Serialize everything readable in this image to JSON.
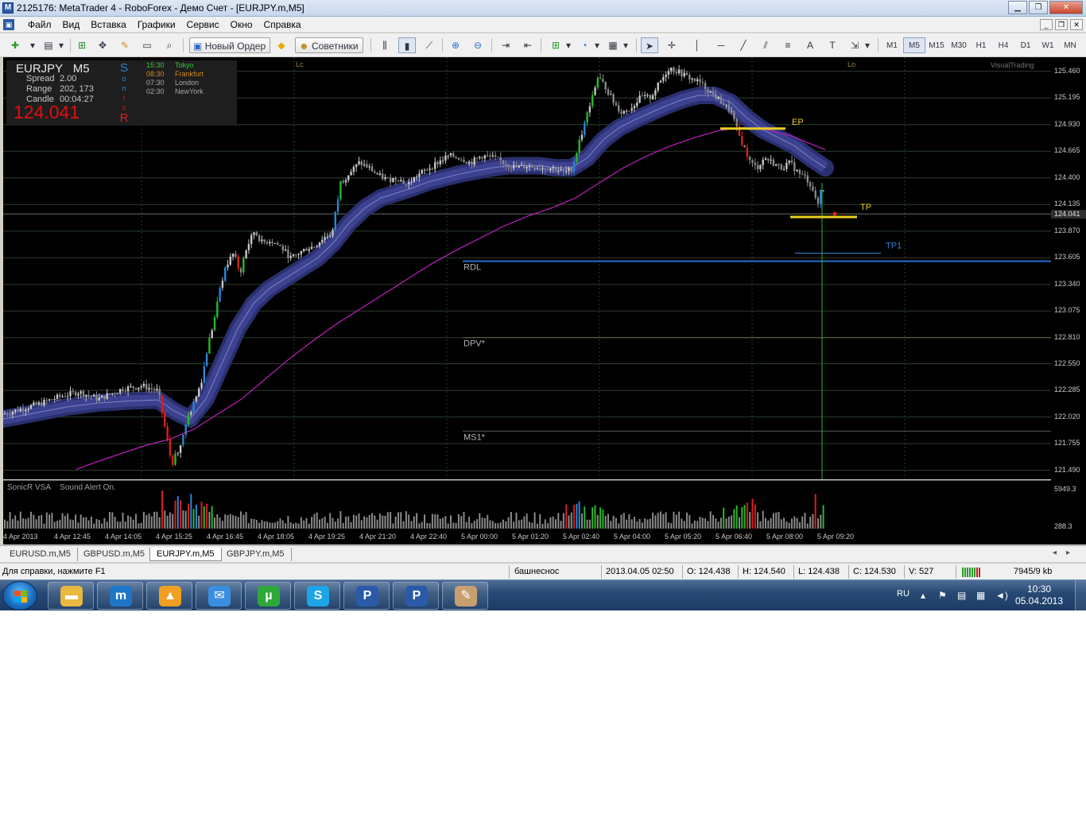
{
  "window": {
    "title": "2125176: MetaTrader 4 - RoboForex - Демо Счет - [EURJPY.m,M5]",
    "app_icon": "metatrader-icon",
    "controls": [
      "minimize",
      "maximize",
      "close"
    ]
  },
  "menubar": {
    "items": [
      "Файл",
      "Вид",
      "Вставка",
      "Графики",
      "Сервис",
      "Окно",
      "Справка"
    ]
  },
  "toolbar": {
    "new_order_label": "Новый Ордер",
    "experts_label": "Советники",
    "timeframes": [
      "M1",
      "M5",
      "M15",
      "M30",
      "H1",
      "H4",
      "D1",
      "W1",
      "MN"
    ],
    "selected_timeframe": "M5"
  },
  "infobox": {
    "symbol": "EURJPY",
    "timeframe": "M5",
    "spread_label": "Spread",
    "spread_value": "2.00",
    "range_label": "Range",
    "range_value": "202, 173",
    "candle_label": "Candle",
    "candle_value": "00:04:27",
    "price": "124.041",
    "sonic_letters": [
      "S",
      "o",
      "n",
      "i",
      "c",
      "R"
    ],
    "sessions": [
      {
        "time": "15:30",
        "name": "Tokyo",
        "color": "#3cc43c"
      },
      {
        "time": "08:30",
        "name": "Frankfurt",
        "color": "#d08820"
      },
      {
        "time": "07:30",
        "name": "London",
        "color": "#a8a8a8"
      },
      {
        "time": "02:30",
        "name": "NewYork",
        "color": "#a8a8a8"
      }
    ]
  },
  "chart": {
    "symbol": "EURJPY.m",
    "timeframe": "M5",
    "watermark": "VisualTrading",
    "session_markers": [
      "Lc",
      "Lo"
    ],
    "levels": [
      {
        "label": "RDL",
        "price": 123.57,
        "color": "#1f6fd0"
      },
      {
        "label": "DPV*",
        "price": 122.81,
        "color": "#6a6a3a"
      },
      {
        "label": "MS1*",
        "price": 121.88,
        "color": "#555555"
      }
    ],
    "trade_marks": [
      {
        "label": "EP",
        "price": 124.89,
        "color": "#e8d020"
      },
      {
        "label": "TP",
        "price": 124.01,
        "color": "#e8d020"
      },
      {
        "label": "TP1",
        "price": 123.65,
        "color": "#2a86d8"
      }
    ],
    "price_axis": [
      "125.460",
      "125.195",
      "124.930",
      "124.665",
      "124.400",
      "124.135",
      "124.041",
      "123.870",
      "123.605",
      "123.340",
      "123.075",
      "122.810",
      "122.550",
      "122.285",
      "122.020",
      "121.755",
      "121.490"
    ],
    "current_price": "124.041",
    "price_min": 121.4,
    "price_max": 125.6,
    "time_axis": [
      "4 Apr 2013",
      "4 Apr 12:45",
      "4 Apr 14:05",
      "4 Apr 15:25",
      "4 Apr 16:45",
      "4 Apr 18:05",
      "4 Apr 19:25",
      "4 Apr 21:20",
      "4 Apr 22:40",
      "5 Apr 00:00",
      "5 Apr 01:20",
      "5 Apr 02:40",
      "5 Apr 04:00",
      "5 Apr 05:20",
      "5 Apr 06:40",
      "5 Apr 08:00",
      "5 Apr 09:20"
    ],
    "price_path": [
      [
        0,
        122.05
      ],
      [
        22,
        122.1
      ],
      [
        45,
        122.15
      ],
      [
        70,
        122.22
      ],
      [
        95,
        122.27
      ],
      [
        120,
        122.2
      ],
      [
        150,
        122.3
      ],
      [
        175,
        122.33
      ],
      [
        195,
        122.28
      ],
      [
        205,
        121.85
      ],
      [
        212,
        121.55
      ],
      [
        222,
        121.72
      ],
      [
        232,
        122.0
      ],
      [
        242,
        122.2
      ],
      [
        250,
        122.4
      ],
      [
        258,
        122.75
      ],
      [
        266,
        123.0
      ],
      [
        274,
        123.35
      ],
      [
        282,
        123.55
      ],
      [
        290,
        123.65
      ],
      [
        298,
        123.45
      ],
      [
        306,
        123.7
      ],
      [
        316,
        123.87
      ],
      [
        326,
        123.75
      ],
      [
        336,
        123.78
      ],
      [
        348,
        123.72
      ],
      [
        362,
        123.6
      ],
      [
        372,
        123.65
      ],
      [
        382,
        123.7
      ],
      [
        392,
        123.72
      ],
      [
        402,
        123.8
      ],
      [
        414,
        123.85
      ],
      [
        424,
        124.35
      ],
      [
        436,
        124.45
      ],
      [
        448,
        124.55
      ],
      [
        460,
        124.5
      ],
      [
        472,
        124.42
      ],
      [
        484,
        124.38
      ],
      [
        496,
        124.4
      ],
      [
        508,
        124.33
      ],
      [
        520,
        124.42
      ],
      [
        532,
        124.48
      ],
      [
        546,
        124.55
      ],
      [
        560,
        124.62
      ],
      [
        574,
        124.6
      ],
      [
        588,
        124.55
      ],
      [
        602,
        124.62
      ],
      [
        616,
        124.6
      ],
      [
        630,
        124.55
      ],
      [
        644,
        124.5
      ],
      [
        660,
        124.52
      ],
      [
        676,
        124.5
      ],
      [
        692,
        124.5
      ],
      [
        706,
        124.45
      ],
      [
        716,
        124.5
      ],
      [
        724,
        124.75
      ],
      [
        732,
        124.95
      ],
      [
        740,
        125.2
      ],
      [
        748,
        125.4
      ],
      [
        758,
        125.3
      ],
      [
        768,
        125.15
      ],
      [
        778,
        125.05
      ],
      [
        790,
        125.1
      ],
      [
        802,
        125.2
      ],
      [
        814,
        125.2
      ],
      [
        826,
        125.35
      ],
      [
        838,
        125.5
      ],
      [
        850,
        125.45
      ],
      [
        862,
        125.4
      ],
      [
        876,
        125.35
      ],
      [
        890,
        125.25
      ],
      [
        904,
        125.15
      ],
      [
        916,
        125.05
      ],
      [
        924,
        124.85
      ],
      [
        932,
        124.7
      ],
      [
        940,
        124.55
      ],
      [
        948,
        124.5
      ],
      [
        958,
        124.6
      ],
      [
        968,
        124.55
      ],
      [
        978,
        124.5
      ],
      [
        990,
        124.55
      ],
      [
        1000,
        124.45
      ],
      [
        1010,
        124.4
      ],
      [
        1018,
        124.3
      ],
      [
        1024,
        124.1
      ],
      [
        1030,
        124.35
      ],
      [
        1036,
        124.04
      ]
    ],
    "ema_band": [
      [
        0,
        122.0
      ],
      [
        40,
        122.06
      ],
      [
        80,
        122.12
      ],
      [
        120,
        122.16
      ],
      [
        160,
        122.18
      ],
      [
        195,
        122.19
      ],
      [
        215,
        122.08
      ],
      [
        235,
        122.0
      ],
      [
        255,
        122.2
      ],
      [
        275,
        122.55
      ],
      [
        295,
        122.9
      ],
      [
        315,
        123.15
      ],
      [
        335,
        123.3
      ],
      [
        355,
        123.4
      ],
      [
        375,
        123.5
      ],
      [
        395,
        123.6
      ],
      [
        415,
        123.75
      ],
      [
        435,
        123.95
      ],
      [
        455,
        124.1
      ],
      [
        475,
        124.2
      ],
      [
        495,
        124.25
      ],
      [
        515,
        124.3
      ],
      [
        535,
        124.36
      ],
      [
        555,
        124.4
      ],
      [
        575,
        124.44
      ],
      [
        595,
        124.47
      ],
      [
        615,
        124.5
      ],
      [
        635,
        124.52
      ],
      [
        655,
        124.52
      ],
      [
        675,
        124.52
      ],
      [
        695,
        124.5
      ],
      [
        715,
        124.5
      ],
      [
        735,
        124.6
      ],
      [
        755,
        124.78
      ],
      [
        775,
        124.9
      ],
      [
        795,
        124.98
      ],
      [
        815,
        125.05
      ],
      [
        835,
        125.12
      ],
      [
        855,
        125.18
      ],
      [
        875,
        125.22
      ],
      [
        895,
        125.22
      ],
      [
        915,
        125.15
      ],
      [
        935,
        125.0
      ],
      [
        955,
        124.88
      ],
      [
        975,
        124.8
      ],
      [
        995,
        124.72
      ],
      [
        1015,
        124.6
      ],
      [
        1034,
        124.5
      ]
    ],
    "ma_magenta": [
      [
        92,
        121.5
      ],
      [
        120,
        121.58
      ],
      [
        150,
        121.66
      ],
      [
        180,
        121.74
      ],
      [
        210,
        121.8
      ],
      [
        240,
        121.9
      ],
      [
        270,
        122.05
      ],
      [
        300,
        122.2
      ],
      [
        330,
        122.4
      ],
      [
        360,
        122.6
      ],
      [
        390,
        122.78
      ],
      [
        420,
        122.95
      ],
      [
        450,
        123.1
      ],
      [
        480,
        123.25
      ],
      [
        510,
        123.4
      ],
      [
        540,
        123.55
      ],
      [
        570,
        123.68
      ],
      [
        600,
        123.8
      ],
      [
        630,
        123.92
      ],
      [
        660,
        124.02
      ],
      [
        690,
        124.1
      ],
      [
        720,
        124.2
      ],
      [
        750,
        124.35
      ],
      [
        780,
        124.5
      ],
      [
        810,
        124.62
      ],
      [
        840,
        124.72
      ],
      [
        870,
        124.8
      ],
      [
        900,
        124.87
      ],
      [
        930,
        124.9
      ],
      [
        960,
        124.88
      ],
      [
        990,
        124.82
      ],
      [
        1015,
        124.74
      ],
      [
        1034,
        124.68
      ]
    ]
  },
  "indicator": {
    "name": "SonicR VSA",
    "status": "Sound Alert On.",
    "scale_top": "5949.3",
    "scale_bottom": "288.3"
  },
  "tabs": [
    "EURUSD.m,M5",
    "GBPUSD.m,M5",
    "EURJPY.m,M5",
    "GBPJPY.m,M5"
  ],
  "active_tab": "EURJPY.m,M5",
  "statusbar": {
    "help": "Для справки, нажмите F1",
    "profile": "башнеснос",
    "datetime": "2013.04.05 02:50",
    "open": "O: 124.438",
    "high": "H: 124.540",
    "low": "L: 124.438",
    "close": "C: 124.530",
    "volume": "V: 527",
    "traffic": "7945/9 kb"
  },
  "taskbar": {
    "apps": [
      {
        "name": "explorer-icon",
        "color": "#e8b840"
      },
      {
        "name": "maxthon-icon",
        "color": "#1e76c8"
      },
      {
        "name": "aimp-icon",
        "color": "#f0a020"
      },
      {
        "name": "thunderbird-icon",
        "color": "#3a8ee0"
      },
      {
        "name": "utorrent-icon",
        "color": "#2fa83a"
      },
      {
        "name": "skype-icon",
        "color": "#1ea5e8"
      },
      {
        "name": "metatrader-icon",
        "color": "#2a5aa8"
      },
      {
        "name": "metatrader-icon",
        "color": "#2a5aa8"
      },
      {
        "name": "paint-icon",
        "color": "#c8a070"
      }
    ],
    "lang": "RU",
    "time": "10:30",
    "date": "05.04.2013"
  }
}
